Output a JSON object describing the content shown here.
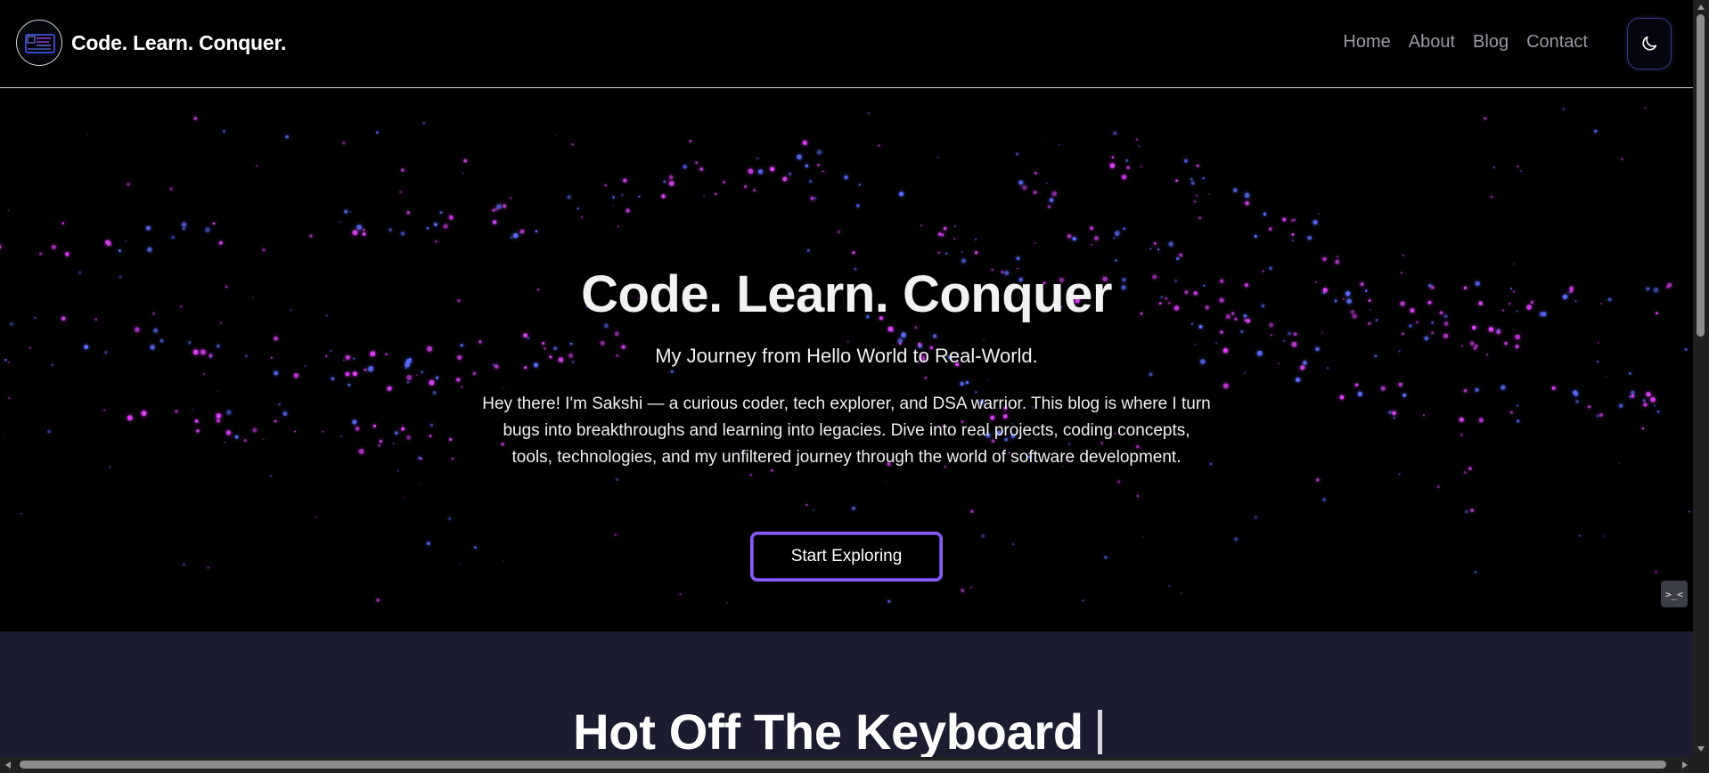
{
  "header": {
    "brand": "Code. Learn. Conquer.",
    "logo_icon": "code-learn-conquer-logo",
    "nav": [
      {
        "label": "Home"
      },
      {
        "label": "About"
      },
      {
        "label": "Blog"
      },
      {
        "label": "Contact"
      }
    ],
    "theme_toggle_icon": "moon-icon"
  },
  "hero": {
    "title": "Code. Learn. Conquer",
    "subtitle": "My Journey from Hello World to Real-World.",
    "description": "Hey there! I'm Sakshi — a curious coder, tech explorer, and DSA warrior. This blog is where I turn bugs into breakthroughs and learning into legacies. Dive into real projects, coding concepts, tools, technologies, and my unfiltered journey through the world of software development.",
    "cta": "Start Exploring",
    "terminal_icon": ">_<"
  },
  "latest": {
    "title": "Hot Off The Keyboard"
  },
  "colors": {
    "background": "#000000",
    "section_bg": "#1b1c30",
    "accent_purple": "#8a5cf5",
    "particle_pink": "#e040fb",
    "particle_blue": "#5b6cff",
    "nav_text": "#9a9aa6"
  }
}
